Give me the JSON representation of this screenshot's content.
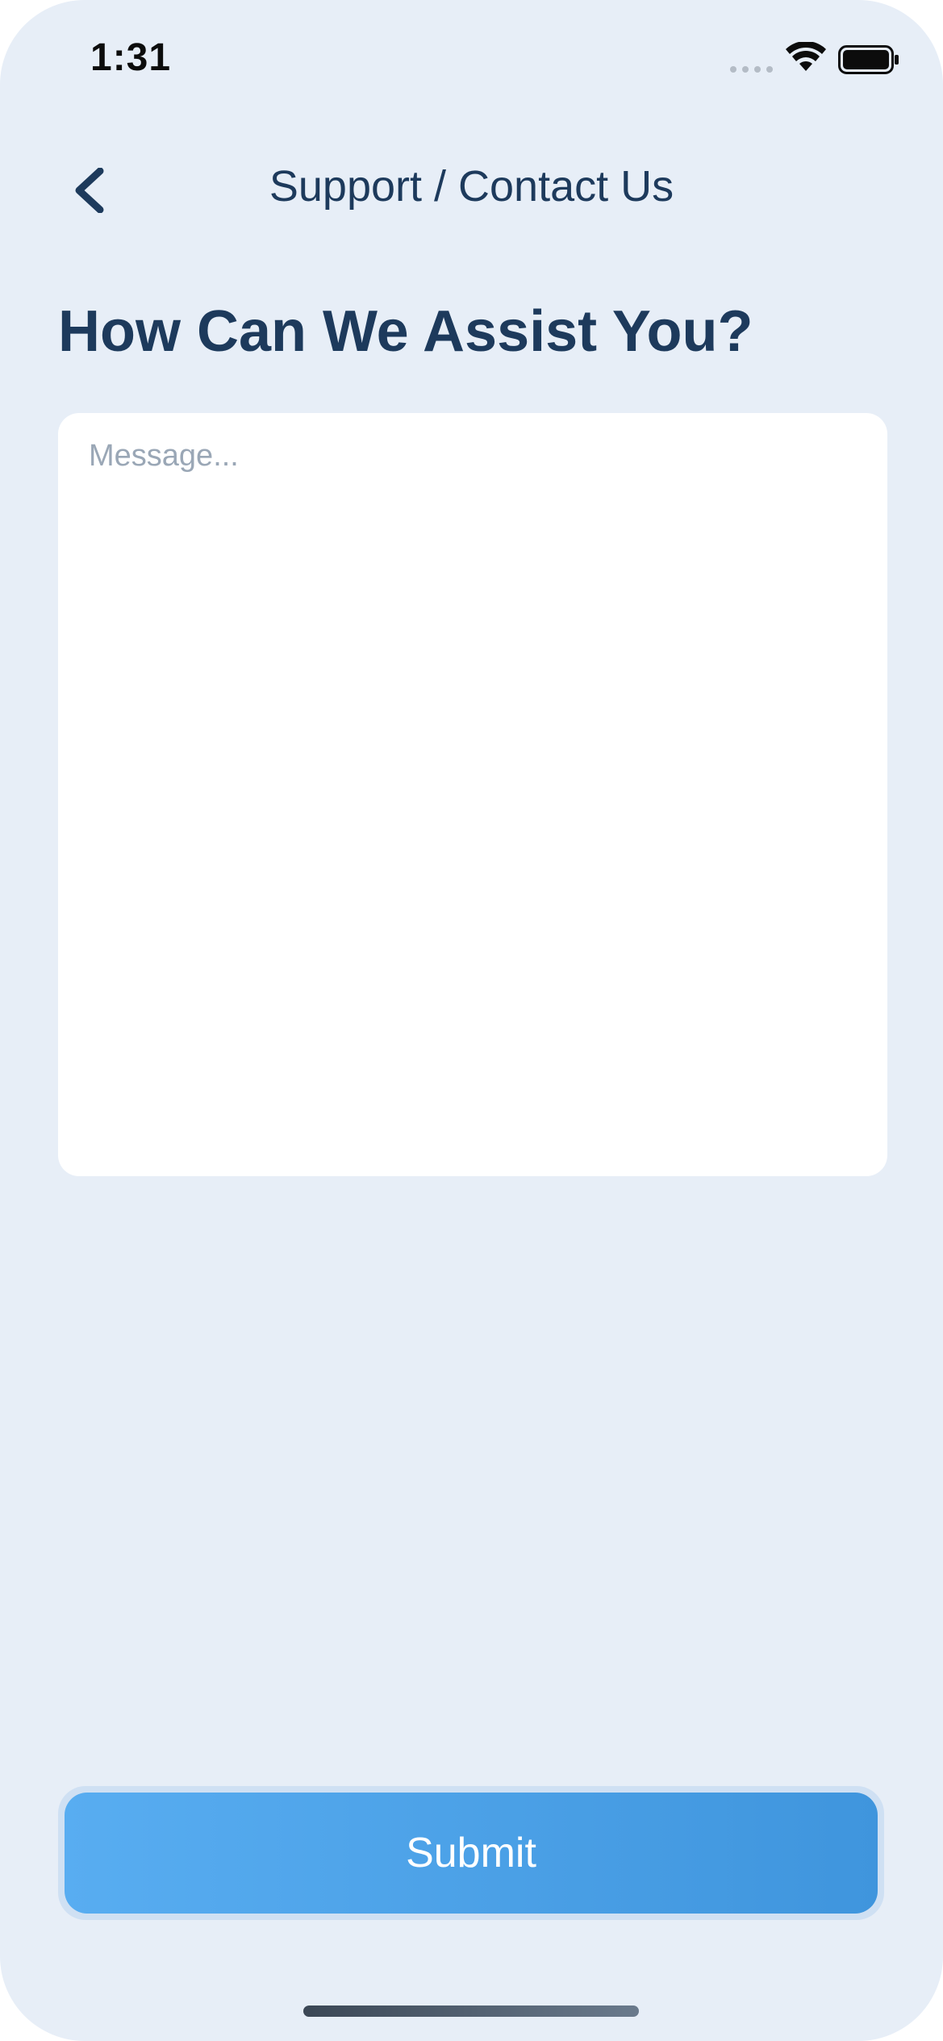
{
  "status_bar": {
    "time": "1:31"
  },
  "icons": {
    "back": "chevron-left-icon",
    "wifi": "wifi-icon",
    "battery": "battery-icon",
    "signal": "signal-dots-icon"
  },
  "nav": {
    "title": "Support / Contact Us"
  },
  "heading": "How Can We Assist You?",
  "message": {
    "value": "",
    "placeholder": "Message..."
  },
  "submit": {
    "label": "Submit"
  },
  "colors": {
    "background": "#e7eef7",
    "text_primary": "#1d3a5c",
    "accent_start": "#58adf1",
    "accent_end": "#3f95dd"
  }
}
